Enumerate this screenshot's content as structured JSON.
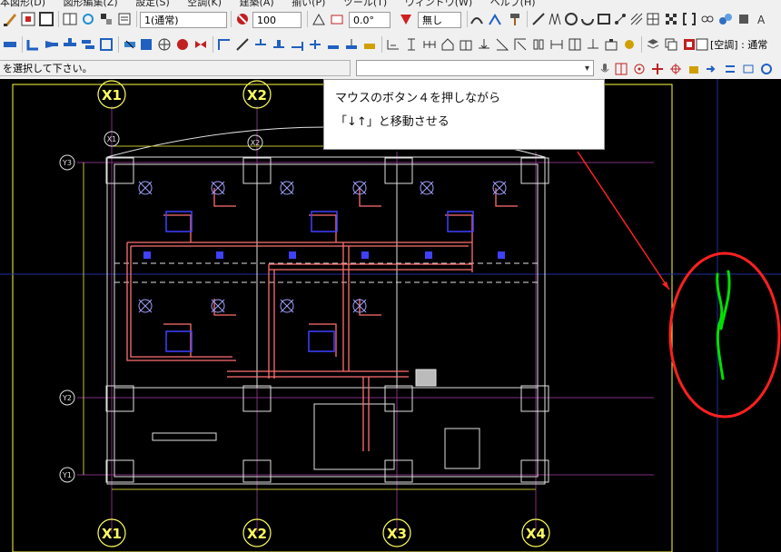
{
  "menu": {
    "items": [
      "本図形(D)",
      "図形編集(Z)",
      "設定(S)",
      "空調(K)",
      "建築(A)",
      "揃い(P)",
      "ツール(T)",
      "ウィンドウ(W)",
      "ヘルプ(H)"
    ]
  },
  "toolbar": {
    "layer_value": "1(通常)",
    "line_type_value": "100",
    "angle_value": "0.0°",
    "fill_value": "無し",
    "mode_label": "[空調] : 通常"
  },
  "status": {
    "prompt": "を選択して下さい。",
    "command_placeholder": ""
  },
  "callout": {
    "line1": "マウスのボタン４を押しながら",
    "line2": "「↓↑」と移動させる"
  },
  "grid_labels": {
    "x_top": [
      "X1",
      "X2"
    ],
    "x_small": [
      "X1",
      "X2"
    ],
    "x_bottom": [
      "X1",
      "X2",
      "X3",
      "X4"
    ],
    "y": [
      "Y3",
      "Y2",
      "Y1"
    ]
  },
  "colors": {
    "accent_red": "#ff2020",
    "gesture_green": "#00e000",
    "label_yellow": "#ffff60",
    "duct_pink": "#ff7070",
    "equipment_blue": "#4040ff"
  }
}
